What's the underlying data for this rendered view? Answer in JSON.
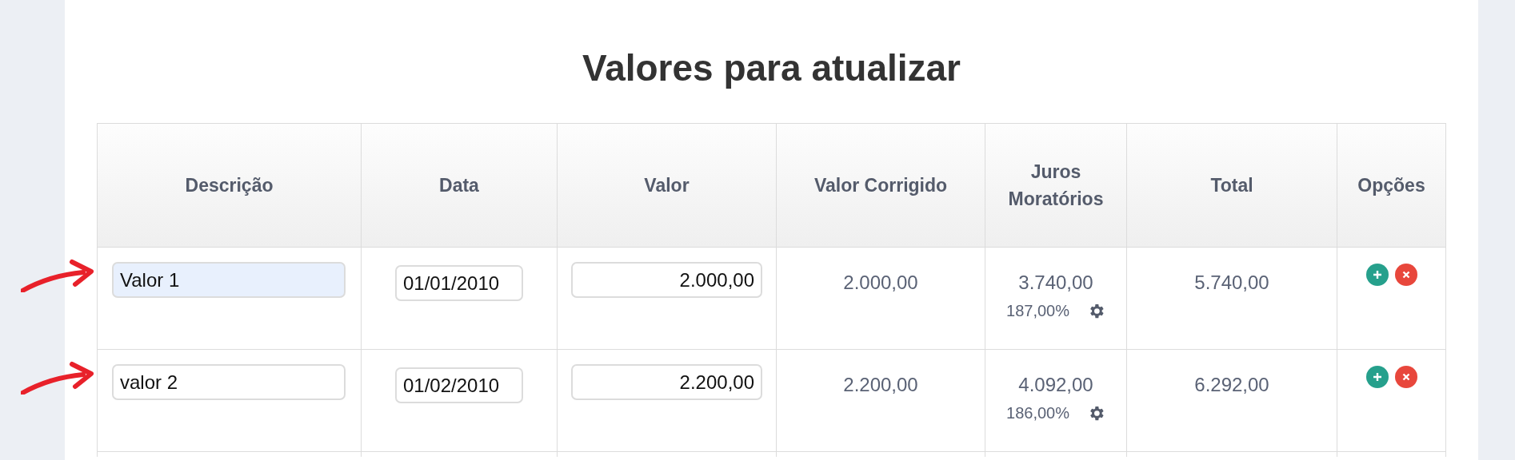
{
  "title": "Valores para atualizar",
  "table": {
    "columns": [
      "Descrição",
      "Data",
      "Valor",
      "Valor Corrigido",
      "Juros Moratórios",
      "Total",
      "Opções"
    ],
    "rows": [
      {
        "marked": true,
        "highlighted": true,
        "description": "Valor 1",
        "date": "01/01/2010",
        "value": "2.000,00",
        "corrected": "2.000,00",
        "interest": "3.740,00",
        "interest_rate": "187,00%",
        "total": "5.740,00"
      },
      {
        "marked": true,
        "highlighted": false,
        "description": "valor 2",
        "date": "01/02/2010",
        "value": "2.200,00",
        "corrected": "2.200,00",
        "interest": "4.092,00",
        "interest_rate": "186,00%",
        "total": "6.292,00"
      }
    ]
  }
}
